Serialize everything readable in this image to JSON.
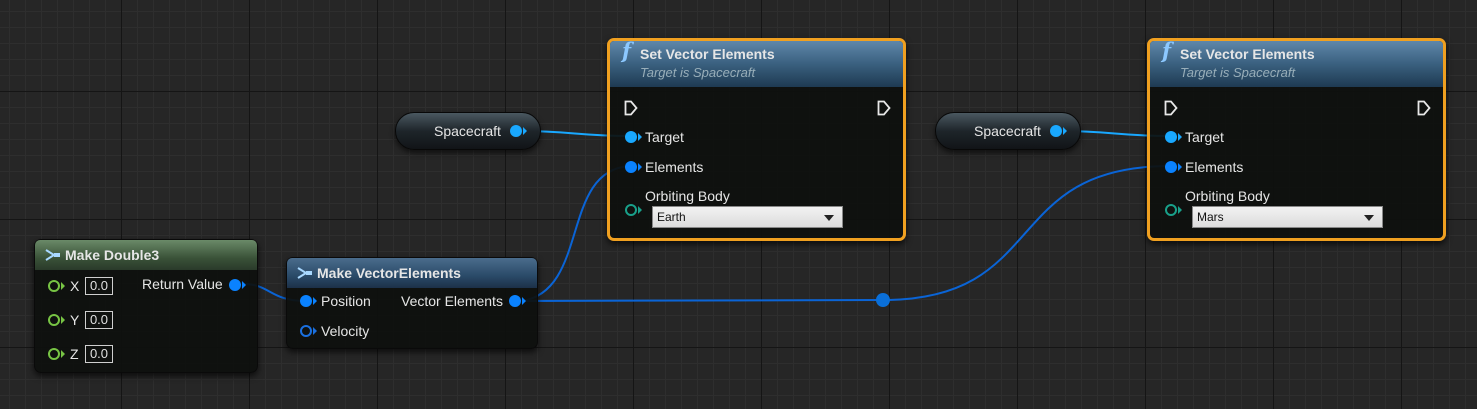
{
  "colors": {
    "vector_wire": "#0a64d6",
    "object_wire": "#19a8ff",
    "selection": "#f0a020"
  },
  "make_double3": {
    "icon": "make-struct-icon",
    "title": "Make Double3",
    "inputs": [
      {
        "label": "X",
        "value": "0.0"
      },
      {
        "label": "Y",
        "value": "0.0"
      },
      {
        "label": "Z",
        "value": "0.0"
      }
    ],
    "output": "Return Value"
  },
  "make_vector_elements": {
    "icon": "make-struct-icon",
    "title": "Make VectorElements",
    "inputs": [
      "Position",
      "Velocity"
    ],
    "output": "Vector Elements"
  },
  "spacecraft_var_1": {
    "label": "Spacecraft"
  },
  "spacecraft_var_2": {
    "label": "Spacecraft"
  },
  "set_vector_elements_1": {
    "icon": "function-icon",
    "title": "Set Vector Elements",
    "subtitle": "Target is Spacecraft",
    "pins": {
      "target": "Target",
      "elements": "Elements",
      "orbiting_body": "Orbiting Body"
    },
    "orbiting_body_value": "Earth"
  },
  "set_vector_elements_2": {
    "icon": "function-icon",
    "title": "Set Vector Elements",
    "subtitle": "Target is Spacecraft",
    "pins": {
      "target": "Target",
      "elements": "Elements",
      "orbiting_body": "Orbiting Body"
    },
    "orbiting_body_value": "Mars"
  }
}
